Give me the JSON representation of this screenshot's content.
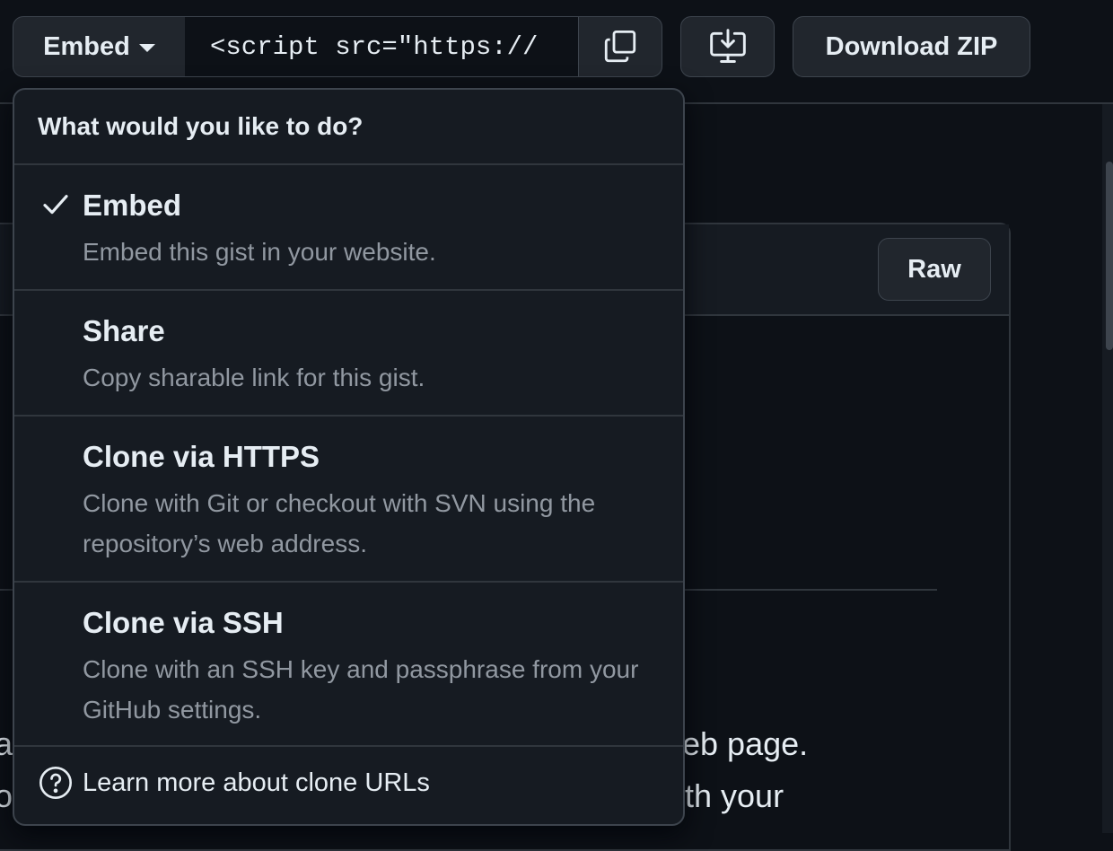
{
  "toolbar": {
    "embed_label": "Embed",
    "url_value": "<script src=\"https://",
    "copy_icon": "copy-icon",
    "desktop_icon": "desktop-download-icon",
    "download_zip_label": "Download ZIP"
  },
  "file": {
    "raw_label": "Raw",
    "text_line1_left": "a",
    "text_line1_right": "eb page.",
    "text_line2_left": "o",
    "text_line2_right": "th your"
  },
  "menu": {
    "title": "What would you like to do?",
    "items": [
      {
        "title": "Embed",
        "description": "Embed this gist in your website.",
        "selected": true
      },
      {
        "title": "Share",
        "description": "Copy sharable link for this gist.",
        "selected": false
      },
      {
        "title": "Clone via HTTPS",
        "description": "Clone with Git or checkout with SVN using the repository’s web address.",
        "selected": false
      },
      {
        "title": "Clone via SSH",
        "description": "Clone with an SSH key and passphrase from your GitHub settings.",
        "selected": false
      }
    ],
    "footer_link": "Learn more about clone URLs",
    "check_icon": "check-icon",
    "help_icon": "question-icon"
  }
}
